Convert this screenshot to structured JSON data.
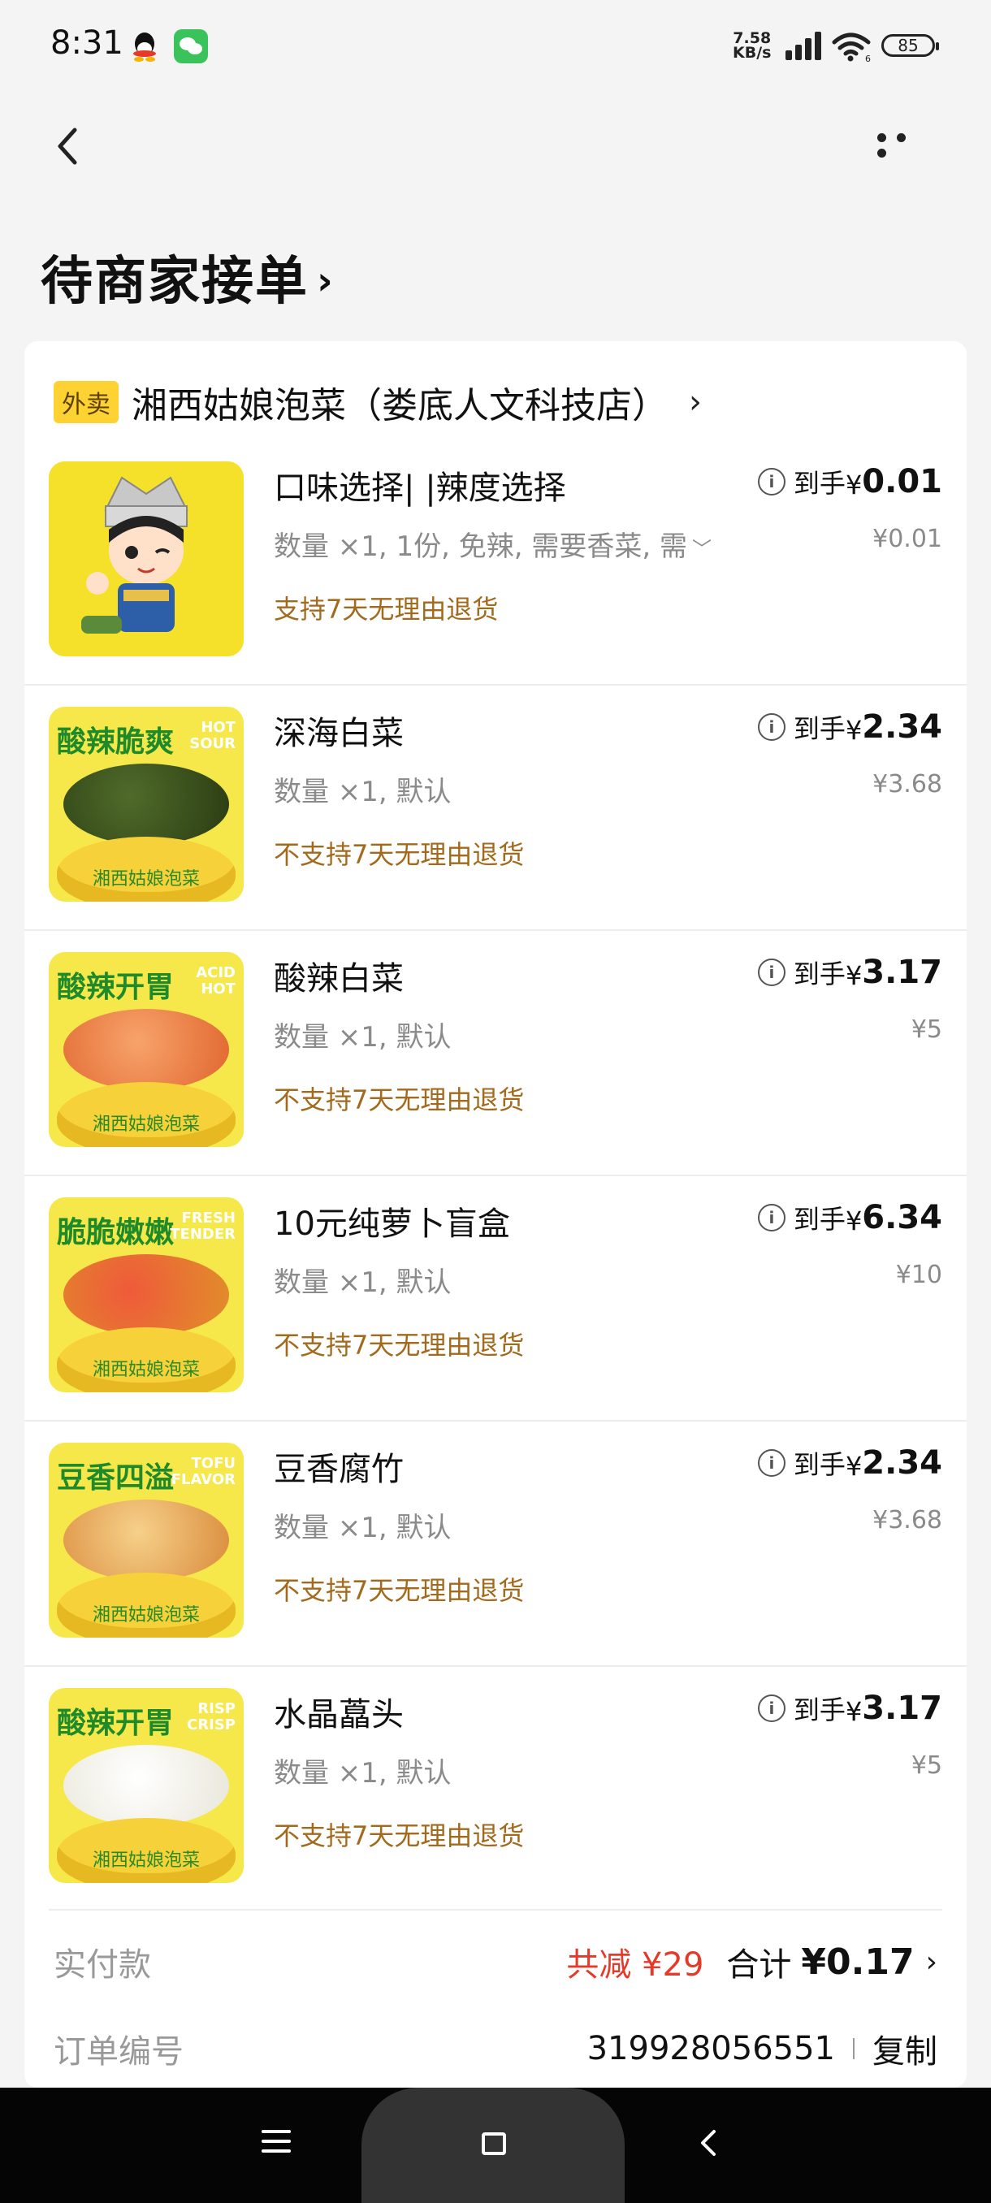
{
  "status_bar": {
    "time": "8:31",
    "net_speed_value": "7.58",
    "net_speed_unit": "KB/s",
    "battery": "85",
    "icons": [
      "qq-icon",
      "wechat-icon",
      "signal-icon",
      "wifi-icon",
      "battery-icon"
    ]
  },
  "header": {
    "title": "待商家接单",
    "chevron": "›"
  },
  "store": {
    "tag": "外卖",
    "name": "湘西姑娘泡菜（娄底人文科技店）",
    "chevron": "›"
  },
  "price_prefix": "到手",
  "items": [
    {
      "name": "口味选择| |辣度选择",
      "specs": "数量 ×1, 1份, 免辣, 需要香菜, 需",
      "has_expand": true,
      "policy": "支持7天无理由退货",
      "price_symbol": "¥",
      "price": "0.01",
      "original_price": "¥0.01",
      "thumb_ribbon": "",
      "thumb_eng": ""
    },
    {
      "name": "深海白菜",
      "specs": "数量 ×1, 默认",
      "has_expand": false,
      "policy": "不支持7天无理由退货",
      "price_symbol": "¥",
      "price": "2.34",
      "original_price": "¥3.68",
      "thumb_ribbon": "酸辣脆爽",
      "thumb_eng": "HOT\nSOUR"
    },
    {
      "name": "酸辣白菜",
      "specs": "数量 ×1, 默认",
      "has_expand": false,
      "policy": "不支持7天无理由退货",
      "price_symbol": "¥",
      "price": "3.17",
      "original_price": "¥5",
      "thumb_ribbon": "酸辣开胃",
      "thumb_eng": "ACID\nHOT"
    },
    {
      "name": "10元纯萝卜盲盒",
      "specs": "数量 ×1, 默认",
      "has_expand": false,
      "policy": "不支持7天无理由退货",
      "price_symbol": "¥",
      "price": "6.34",
      "original_price": "¥10",
      "thumb_ribbon": "脆脆嫩嫩",
      "thumb_eng": "FRESH\nTENDER"
    },
    {
      "name": "豆香腐竹",
      "specs": "数量 ×1, 默认",
      "has_expand": false,
      "policy": "不支持7天无理由退货",
      "price_symbol": "¥",
      "price": "2.34",
      "original_price": "¥3.68",
      "thumb_ribbon": "豆香四溢",
      "thumb_eng": "TOFU\nFLAVOR"
    },
    {
      "name": "水晶藠头",
      "specs": "数量 ×1, 默认",
      "has_expand": false,
      "policy": "不支持7天无理由退货",
      "price_symbol": "¥",
      "price": "3.17",
      "original_price": "¥5",
      "thumb_ribbon": "酸辣开胃",
      "thumb_eng": "RISP\nCRISP"
    }
  ],
  "thumb_brand": "湘西姑娘泡菜",
  "payment": {
    "label": "实付款",
    "discount": "共减 ¥29",
    "total_label": "合计",
    "total": "¥0.17",
    "chevron": "›"
  },
  "order": {
    "label": "订单编号",
    "number": "319928056551",
    "copy_label": "复制"
  },
  "colors": {
    "policy_brown": "#a26a1c",
    "discount_red": "#e53a2a",
    "tag_yellow": "#ffd233",
    "brand_green": "#1e8a2a"
  }
}
